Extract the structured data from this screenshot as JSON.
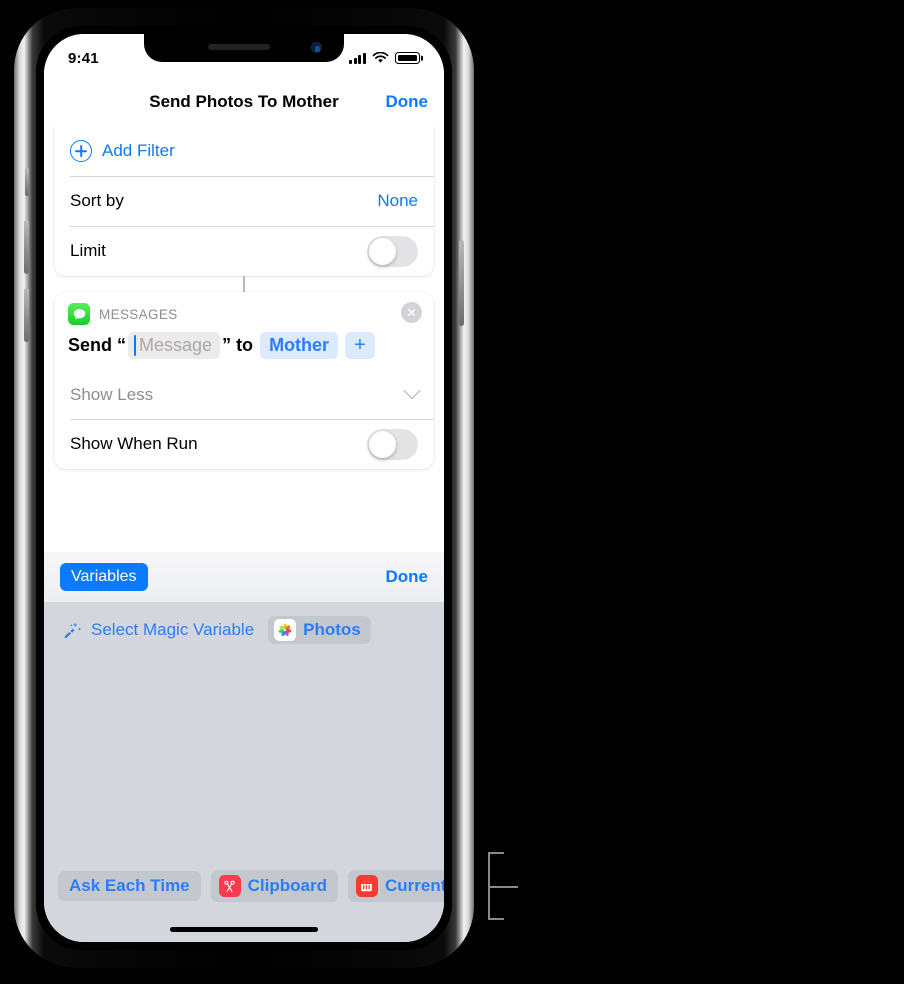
{
  "status_bar": {
    "time": "9:41",
    "cellular_icon": "signal-bars-icon",
    "wifi_icon": "wifi-icon",
    "battery_icon": "battery-full-icon"
  },
  "nav_bar": {
    "title": "Send Photos To Mother",
    "done_label": "Done"
  },
  "filter_card": {
    "add_filter_label": "Add Filter",
    "add_filter_icon": "plus-circle-icon",
    "sort_by_label": "Sort by",
    "sort_by_value": "None",
    "limit_label": "Limit",
    "limit_toggle_state": "off"
  },
  "messages_card": {
    "app_name": "MESSAGES",
    "app_icon": "messages-icon",
    "close_icon": "close-circle-icon",
    "send_prefix": "Send “",
    "message_placeholder": "Message",
    "send_middle": "” to",
    "recipient_token": "Mother",
    "add_recipient_label": "+",
    "show_less_label": "Show Less",
    "show_less_icon": "chevron-down-icon",
    "show_when_run_label": "Show When Run",
    "show_when_run_toggle_state": "off"
  },
  "variables_panel": {
    "variables_button_label": "Variables",
    "done_label": "Done",
    "magic_wand_icon": "magic-wand-icon",
    "select_magic_variable_label": "Select Magic Variable",
    "photos_token_label": "Photos",
    "photos_icon": "photos-icon",
    "tokens": [
      {
        "label": "Ask Each Time",
        "icon": null
      },
      {
        "label": "Clipboard",
        "icon": "clipboard-scissors-icon"
      },
      {
        "label": "Current I",
        "icon": "calendar-icon"
      }
    ]
  },
  "colors": {
    "accent_blue": "#0a7aff",
    "token_blue": "#2b7dfa",
    "messages_green": "#19cc28",
    "clipboard_red": "#fa3b4d",
    "calendar_red": "#f93a2f",
    "panel_gray": "#d3d6dc"
  }
}
